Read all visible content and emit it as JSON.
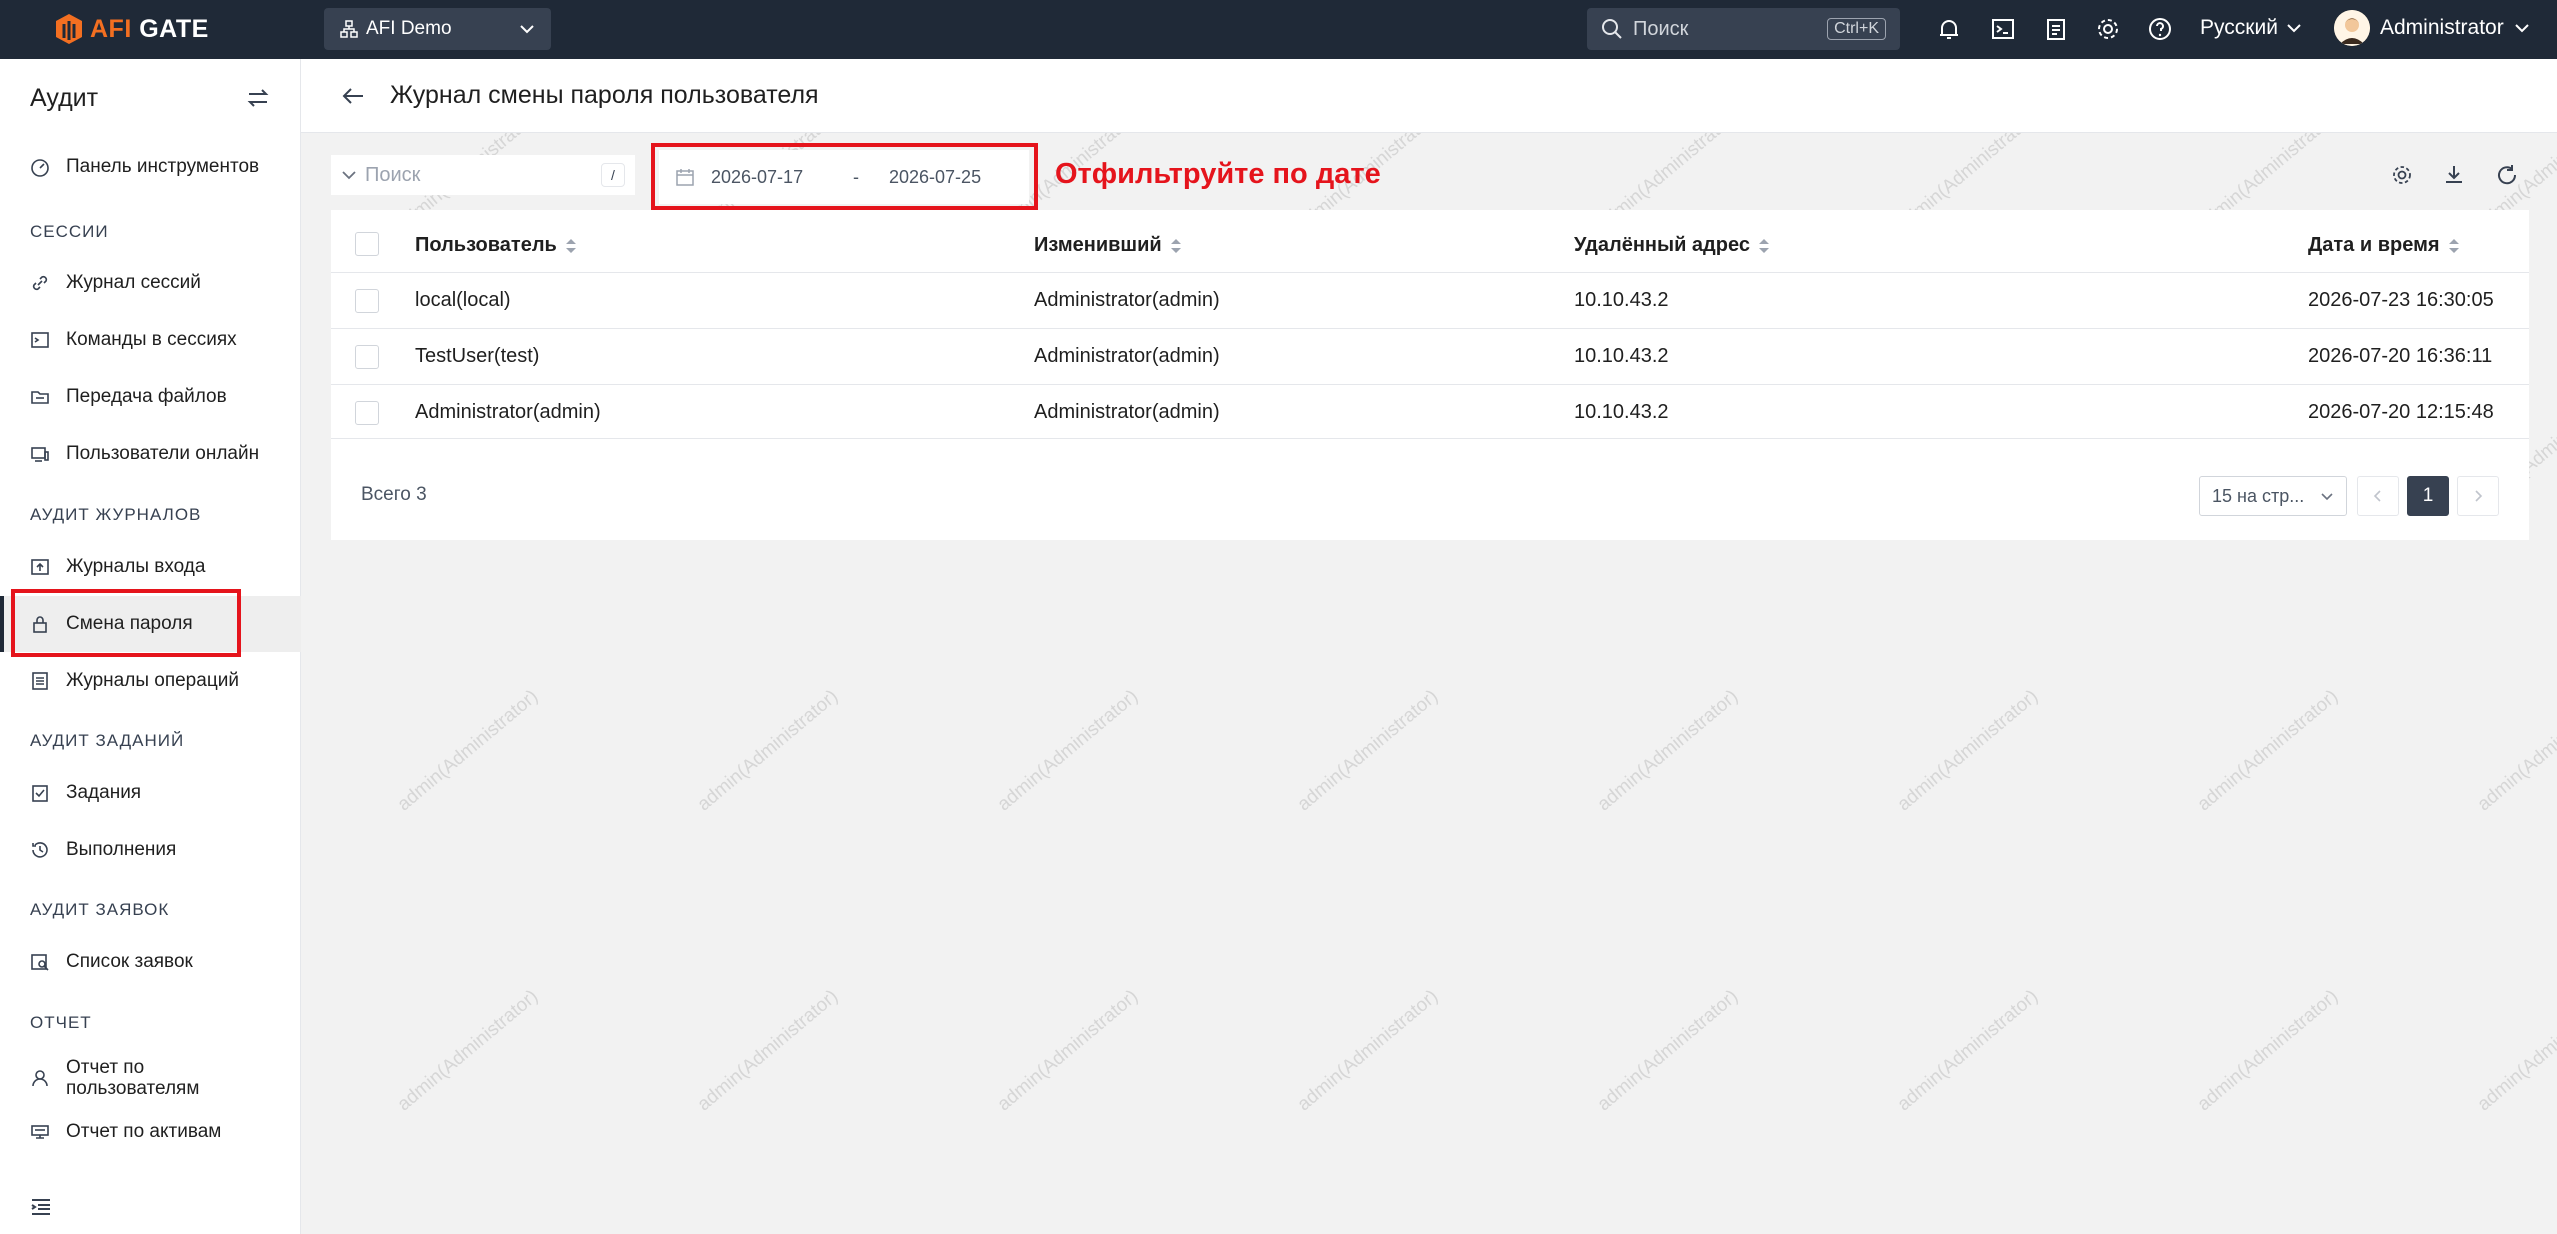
{
  "topbar": {
    "logo_text_afi": "AFI",
    "logo_text_gate": "GATE",
    "org": "AFI Demo",
    "search_placeholder": "Поиск",
    "search_shortcut": "Ctrl+K",
    "language": "Русский",
    "user": "Administrator",
    "icons": [
      "bell-icon",
      "terminal-icon",
      "clipboard-icon",
      "gear-icon",
      "help-icon"
    ]
  },
  "sidebar": {
    "title": "Аудит",
    "items": {
      "dashboard": "Панель инструментов",
      "sessions_section": "СЕССИИ",
      "session_log": "Журнал сессий",
      "session_commands": "Команды в сессиях",
      "file_transfer": "Передача файлов",
      "online_users": "Пользователи онлайн",
      "audit_logs_section": "АУДИТ ЖУРНАЛОВ",
      "login_logs": "Журналы входа",
      "password_change": "Смена пароля",
      "operation_logs": "Журналы операций",
      "tasks_section": "АУДИТ ЗАДАНИЙ",
      "tasks": "Задания",
      "executions": "Выполнения",
      "tickets_section": "АУДИТ ЗАЯВОК",
      "ticket_list": "Список заявок",
      "report_section": "ОТЧЕТ",
      "user_report_line1": "Отчет по",
      "user_report_line2": "пользователям",
      "asset_report": "Отчет по активам"
    }
  },
  "page": {
    "title": "Журнал смены пароля пользователя",
    "search_placeholder": "Поиск",
    "search_slash": "/",
    "date_from": "2026-07-17",
    "date_sep": "-",
    "date_to": "2026-07-25",
    "annotation": "Отфильтруйте по дате"
  },
  "table": {
    "columns": [
      "Пользователь",
      "Изменивший",
      "Удалённый адрес",
      "Дата и время"
    ],
    "rows": [
      [
        "local(local)",
        "Administrator(admin)",
        "10.10.43.2",
        "2026-07-23 16:30:05"
      ],
      [
        "TestUser(test)",
        "Administrator(admin)",
        "10.10.43.2",
        "2026-07-20 16:36:11"
      ],
      [
        "Administrator(admin)",
        "Administrator(admin)",
        "10.10.43.2",
        "2026-07-20 12:15:48"
      ]
    ]
  },
  "pagination": {
    "total": "Всего 3",
    "page_size": "15 на стр...",
    "current": "1"
  },
  "watermark": "admin(Administrator)",
  "colors": {
    "topbar": "#1f2937",
    "accent": "#f36f21",
    "highlight": "#e5141c"
  }
}
